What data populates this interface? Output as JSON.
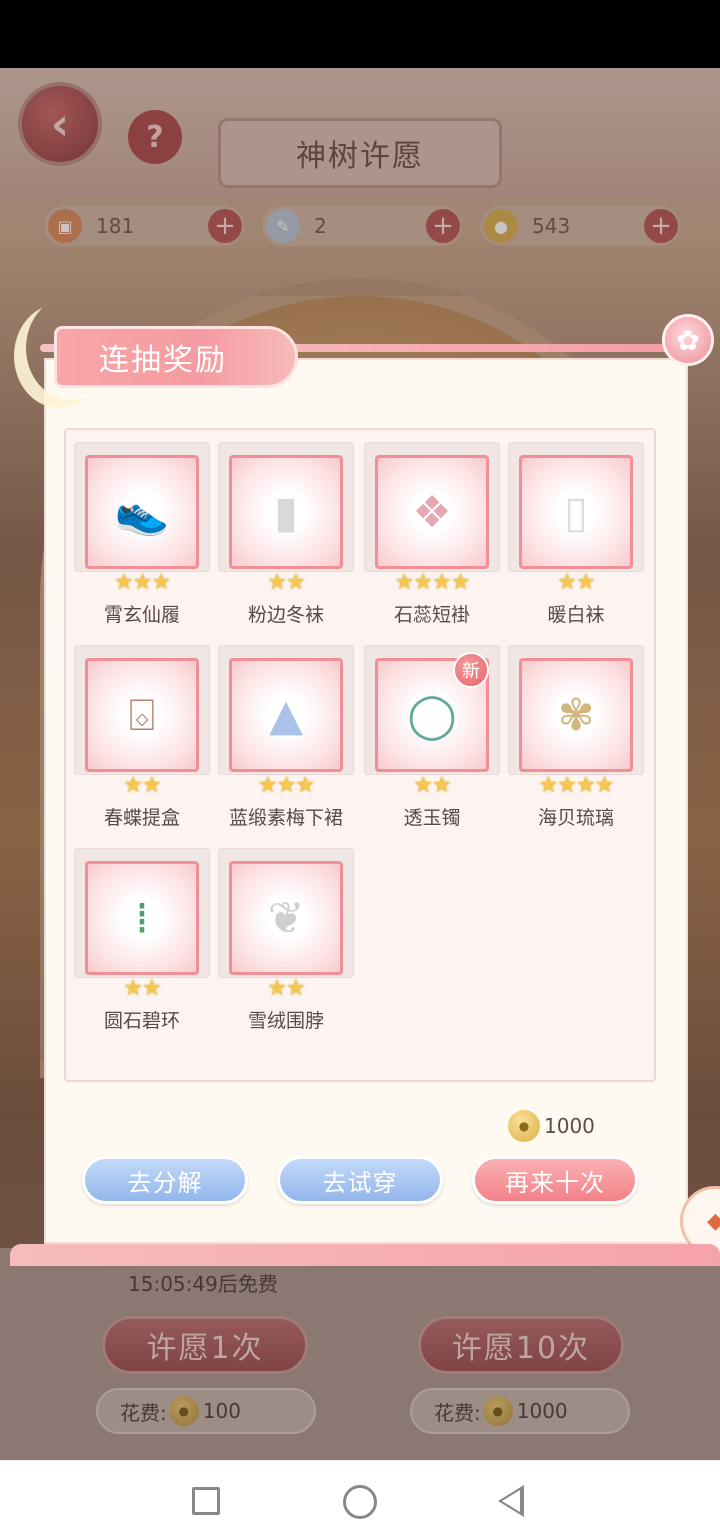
{
  "header": {
    "title": "神树许愿"
  },
  "currencies": [
    {
      "icon": "gift-box-icon",
      "value": "181"
    },
    {
      "icon": "feather-icon",
      "value": "2"
    },
    {
      "icon": "coin-icon",
      "value": "543"
    }
  ],
  "dialog": {
    "title": "连抽奖励",
    "items": [
      {
        "name": "霄玄仙履",
        "stars": "★★★",
        "icon": "shoes-icon",
        "new": false
      },
      {
        "name": "粉边冬袜",
        "stars": "★★",
        "icon": "stockings-icon",
        "new": false
      },
      {
        "name": "石蕊短褂",
        "stars": "★★★★",
        "icon": "jacket-icon",
        "new": false
      },
      {
        "name": "暖白袜",
        "stars": "★★",
        "icon": "socks-icon",
        "new": false
      },
      {
        "name": "春蝶提盒",
        "stars": "★★",
        "icon": "lantern-box-icon",
        "new": false
      },
      {
        "name": "蓝缎素梅下裙",
        "stars": "★★★",
        "icon": "skirt-icon",
        "new": false
      },
      {
        "name": "透玉镯",
        "stars": "★★",
        "icon": "bracelet-icon",
        "new": true,
        "new_label": "新"
      },
      {
        "name": "海贝琉璃",
        "stars": "★★★★",
        "icon": "hairpiece-icon",
        "new": false
      },
      {
        "name": "圆石碧环",
        "stars": "★★",
        "icon": "earrings-icon",
        "new": false
      },
      {
        "name": "雪绒围脖",
        "stars": "★★",
        "icon": "scarf-icon",
        "new": false
      }
    ],
    "reroll_cost": "1000",
    "buttons": {
      "decompose": "去分解",
      "try_on": "去试穿",
      "again_ten": "再来十次"
    }
  },
  "bottom": {
    "free_timer": "15:05:49后免费",
    "wish_once": "许愿1次",
    "wish_ten": "许愿10次",
    "cost_label": "花费:",
    "cost_once": "100",
    "cost_ten": "1000"
  },
  "colors": {
    "accent_pink": "#f28187",
    "accent_blue": "#92b6ec",
    "star_gold": "#f5c74e"
  }
}
